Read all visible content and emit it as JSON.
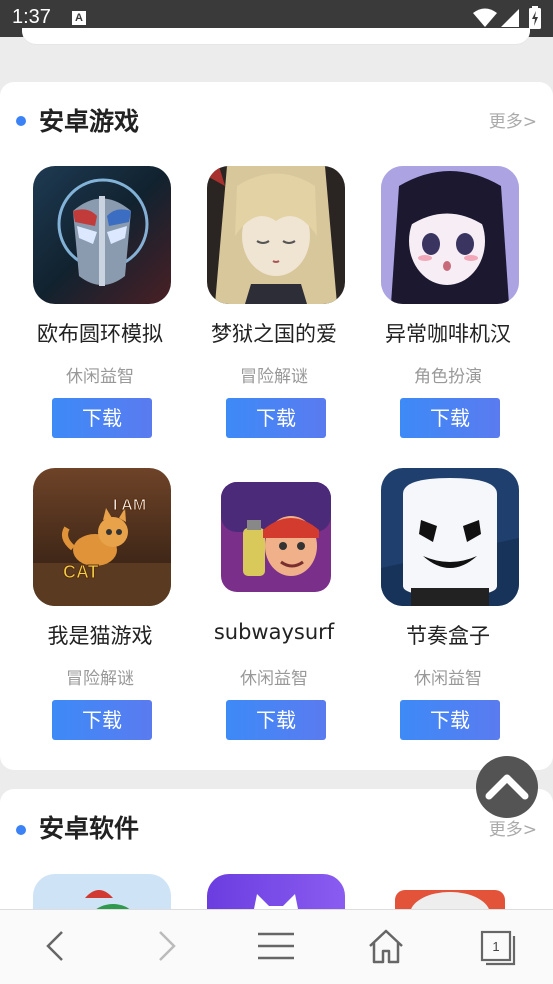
{
  "status": {
    "time": "1:37",
    "notification_icon": "A"
  },
  "sections": [
    {
      "title": "安卓游戏",
      "more": "更多>",
      "apps": [
        {
          "name": "欧布圆环模拟",
          "category": "休闲益智",
          "button": "下载",
          "icon": "ultraman-mask-icon"
        },
        {
          "name": "梦狱之国的爱",
          "category": "冒险解谜",
          "button": "下载",
          "icon": "anime-girl-blonde-icon"
        },
        {
          "name": "异常咖啡机汉",
          "category": "角色扮演",
          "button": "下载",
          "icon": "anime-girl-dark-hair-icon"
        },
        {
          "name": "我是猫游戏",
          "category": "冒险解谜",
          "button": "下载",
          "icon": "cat-game-icon"
        },
        {
          "name": "subwaysurf",
          "category": "休闲益智",
          "button": "下载",
          "icon": "subway-surf-icon"
        },
        {
          "name": "节奏盒子",
          "category": "休闲益智",
          "button": "下载",
          "icon": "marshmello-icon"
        }
      ]
    },
    {
      "title": "安卓软件",
      "more": "更多>"
    }
  ],
  "bottom_nav": {
    "tab_count": "1"
  }
}
